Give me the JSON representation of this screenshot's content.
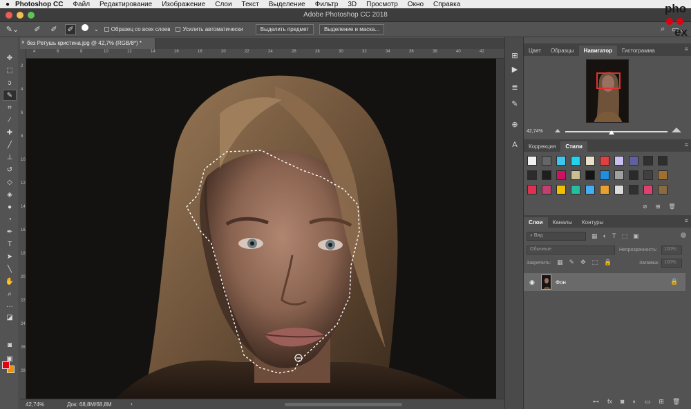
{
  "menubar": {
    "apple": "",
    "app": "Photoshop CC",
    "items": [
      "Файл",
      "Редактирование",
      "Изображение",
      "Слои",
      "Текст",
      "Выделение",
      "Фильтр",
      "3D",
      "Просмотр",
      "Окно",
      "Справка"
    ]
  },
  "window": {
    "title": "Adobe Photoshop CC 2018"
  },
  "options": {
    "brush_size": "30",
    "sample_all_layers": "Образец со всех слоев",
    "auto_enhance": "Усилить автоматически",
    "select_subject": "Выделить предмет",
    "select_and_mask": "Выделение и маска..."
  },
  "document": {
    "tab_title": "без Ретушь кристина.jpg @ 42,7% (RGB/8*) *",
    "zoom": "42,74%",
    "doc_info": "Док: 68,8M/68,8M",
    "ruler_ticks": [
      "4",
      "6",
      "8",
      "10",
      "12",
      "14",
      "16",
      "18",
      "20",
      "22",
      "24",
      "26",
      "28",
      "30",
      "32",
      "34",
      "36",
      "38",
      "40",
      "42"
    ]
  },
  "panels": {
    "top_tabs": [
      "Цвет",
      "Образцы",
      "Навигатор",
      "Гистограмма"
    ],
    "top_active": "Навигатор",
    "navigator_zoom": "42,74%",
    "navigator_zoom_fraction": 0.43,
    "mid_tabs": [
      "Коррекция",
      "Стили"
    ],
    "mid_active": "Стили",
    "layer_tabs": [
      "Слои",
      "Каналы",
      "Контуры"
    ],
    "layer_active": "Слои",
    "search_placeholder": "Вид",
    "blend_mode": "Обычные",
    "opacity_label": "Непрозрачность:",
    "opacity_value": "100%",
    "lock_label": "Закрепить:",
    "fill_label": "Заливка:",
    "fill_value": "100%",
    "layer_name": "Фон"
  },
  "style_swatches": [
    "#f0f0f0",
    "#666666",
    "#3ec7ee",
    "#22d3f0",
    "#e8e0c8",
    "#e04040",
    "#c8c0f0",
    "#6060a0",
    "#303030",
    "#2e2e2e",
    "#2c2c2c",
    "#1e1e1e",
    "#d01060",
    "#c8c090",
    "#141414",
    "#1e8ee0",
    "#a0a0a0",
    "#2a2a2a",
    "#404040",
    "#a07030",
    "#e03050",
    "#c04070",
    "#f0c000",
    "#20c0a0",
    "#40b0f0",
    "#e8a030",
    "#dcdcdc",
    "#303030",
    "#e04070",
    "#8a6a40"
  ],
  "watermark": {
    "line1": "pho",
    "line2": "ex"
  },
  "colors": {
    "foreground": "#e60012",
    "background": "#f29100",
    "accent_red": "#e0322e"
  }
}
